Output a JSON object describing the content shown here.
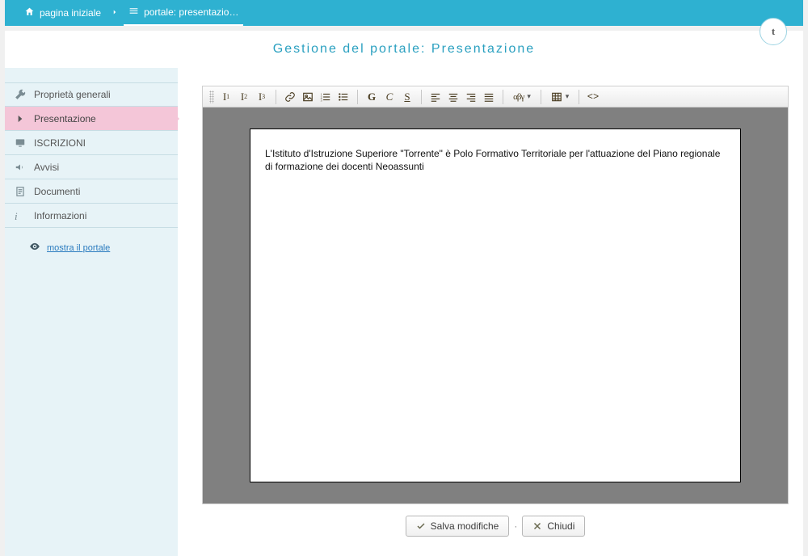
{
  "breadcrumb": {
    "home": "pagina iniziale",
    "current": "portale: presentazio…"
  },
  "avatar_initial": "t",
  "page_title": "Gestione del portale: Presentazione",
  "sidebar": {
    "items": [
      {
        "label": "Proprietà generali"
      },
      {
        "label": "Presentazione"
      },
      {
        "label": "ISCRIZIONI"
      },
      {
        "label": "Avvisi"
      },
      {
        "label": "Documenti"
      },
      {
        "label": "Informazioni"
      }
    ],
    "show_portal": "mostra il portale"
  },
  "toolbar": {
    "h1": "I",
    "h2": "I",
    "h3": "I",
    "bold": "G",
    "italic": "C",
    "underline": "S",
    "chars": "αβγ",
    "code": "<>"
  },
  "editor": {
    "content": "L'Istituto d'Istruzione Superiore \"Torrente\"  è Polo Formativo Territoriale  per l'attuazione del Piano regionale di formazione dei docenti Neoassunti"
  },
  "footer": {
    "save": "Salva modifiche",
    "close": "Chiudi"
  }
}
